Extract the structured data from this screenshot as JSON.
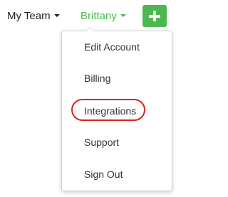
{
  "nav": {
    "team_label": "My Team",
    "user_label": "Brittany",
    "add_button_symbol": "+",
    "user_color": "#4cb84f",
    "add_button_color": "#4cb84f"
  },
  "dropdown": {
    "items": [
      {
        "label": "Edit Account"
      },
      {
        "label": "Billing"
      },
      {
        "label": "Integrations",
        "highlighted": true
      },
      {
        "label": "Support"
      },
      {
        "label": "Sign Out"
      }
    ]
  },
  "highlight": {
    "target": "Integrations",
    "color": "#d9231f"
  }
}
